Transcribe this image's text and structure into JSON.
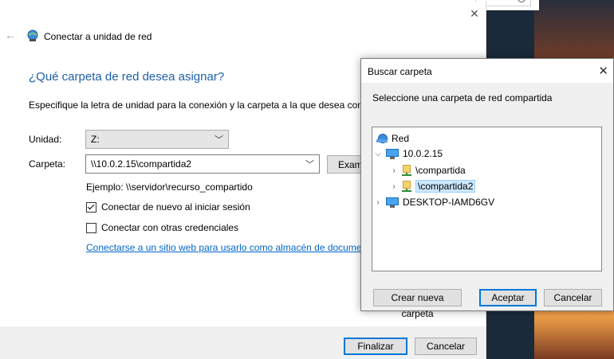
{
  "wizard": {
    "title": "Conectar a unidad de red",
    "close_glyph": "✕",
    "back_glyph": "←",
    "heading": "¿Qué carpeta de red desea asignar?",
    "instruction": "Especifique la letra de unidad para la conexión y la carpeta a la que desea conectarse:",
    "unidad_label": "Unidad:",
    "unidad_value": "Z:",
    "carpeta_label": "Carpeta:",
    "carpeta_value": "\\\\10.0.2.15\\compartida2",
    "examinar_label": "Examinar...",
    "ejemplo": "Ejemplo: \\\\servidor\\recurso_compartido",
    "reconnect_label": "Conectar de nuevo al iniciar sesión",
    "reconnect_checked": true,
    "credentials_label": "Conectar con otras credenciales",
    "credentials_checked": false,
    "web_link": "Conectarse a un sitio web para usarlo como almacén de documentos e imágenes",
    "finalizar_label": "Finalizar",
    "cancelar_label": "Cancelar"
  },
  "browse_dialog": {
    "title": "Buscar carpeta",
    "close_glyph": "✕",
    "description": "Seleccione una carpeta de red compartida",
    "tree": [
      {
        "label": "Red",
        "icon": "network-icon",
        "expanded": true
      },
      {
        "label": "10.0.2.15",
        "icon": "computer-icon",
        "expanded": true
      },
      {
        "label": "\\compartida",
        "icon": "shared-folder-icon",
        "expanded": false
      },
      {
        "label": "\\compartida2",
        "icon": "shared-folder-icon",
        "expanded": false,
        "selected": true
      },
      {
        "label": "DESKTOP-IAMD6GV",
        "icon": "computer-icon",
        "expanded": false
      }
    ],
    "crear_label": "Crear nueva carpeta",
    "aceptar_label": "Aceptar",
    "cancelar_label": "Cancelar"
  },
  "colors": {
    "heading": "#1f5fa8",
    "link": "#0066cc",
    "default_button_border": "#0078d7",
    "selection": "#cde8ff"
  }
}
